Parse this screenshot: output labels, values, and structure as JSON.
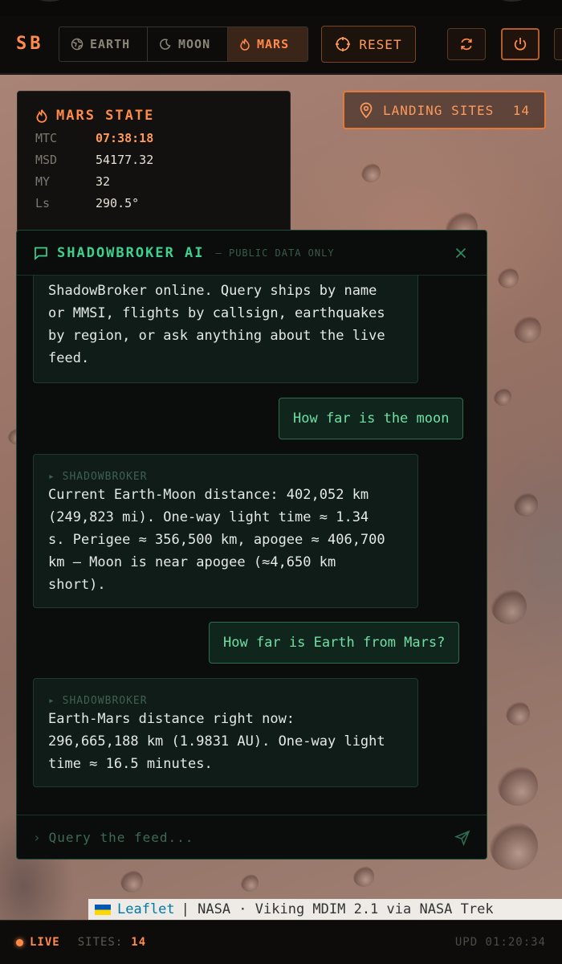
{
  "header": {
    "logo": "SB",
    "tabs": [
      {
        "label": "EARTH",
        "icon": "globe-icon",
        "active": false
      },
      {
        "label": "MOON",
        "icon": "moon-icon",
        "active": false
      },
      {
        "label": "MARS",
        "icon": "flame-icon",
        "active": true
      }
    ],
    "reset_label": "RESET",
    "refresh_icon": "refresh-icon",
    "power_icon": "power-icon"
  },
  "colors": {
    "accent": "#ff8a4a",
    "chat_accent": "#3fcf8e",
    "background": "#0b0a09"
  },
  "state_panel": {
    "title": "MARS STATE",
    "rows": [
      {
        "key": "MTC",
        "value": "07:38:18"
      },
      {
        "key": "MSD",
        "value": "54177.32"
      },
      {
        "key": "MY",
        "value": "32"
      },
      {
        "key": "Ls",
        "value": "290.5°"
      }
    ]
  },
  "landing_sites": {
    "label": "LANDING SITES",
    "count": "14"
  },
  "chat": {
    "title": "SHADOWBROKER AI",
    "subtitle": "— PUBLIC DATA ONLY",
    "messages": [
      {
        "role": "bot",
        "label": "",
        "lines": [
          "ShadowBroker online. Query ships by name",
          "or MMSI, flights by callsign, earthquakes",
          "by region, or ask anything about the live",
          "feed."
        ]
      },
      {
        "role": "user",
        "text": "How far is the moon"
      },
      {
        "role": "bot",
        "label": "▸ SHADOWBROKER",
        "lines": [
          "Current Earth-Moon distance: 402,052 km",
          "(249,823 mi). One-way light time ≈ 1.34",
          "s. Perigee ≈ 356,500 km, apogee ≈ 406,700",
          "km — Moon is near apogee (≈4,650 km",
          "short)."
        ]
      },
      {
        "role": "user",
        "text": "How far is Earth from Mars?"
      },
      {
        "role": "bot",
        "label": "▸ SHADOWBROKER",
        "lines": [
          "Earth-Mars distance right now:",
          "296,665,188 km (1.9831 AU). One-way light",
          "time ≈ 16.5 minutes."
        ]
      }
    ],
    "input_prompt": "›",
    "input_placeholder": "Query the feed...",
    "input_value": ""
  },
  "attribution": {
    "leaflet": "Leaflet",
    "rest": "| NASA · Viking MDIM 2.1 via NASA Trek"
  },
  "footer": {
    "live": "LIVE",
    "sites_label": "SITES:",
    "sites_value": "14",
    "updated": "UPD 01:20:34"
  }
}
